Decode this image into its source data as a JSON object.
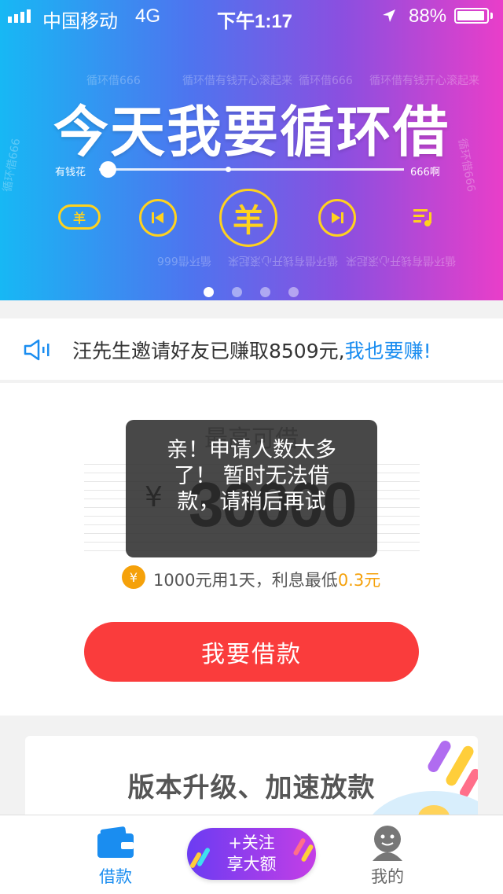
{
  "status_bar": {
    "carrier": "中国移动",
    "network": "4G",
    "time": "下午1:17",
    "battery": "88%"
  },
  "banner": {
    "watermark_a": "循环借有钱开心滚起来",
    "watermark_b": "循环借666",
    "title": "今天我要循环借",
    "slider_left": "有钱花",
    "slider_right": "666啊",
    "center_symbol": "羊",
    "left_symbol": "羊",
    "slides_total": 4,
    "slide_active": 1
  },
  "notice": {
    "text": "汪先生邀请好友已赚取8509元,",
    "link": "我也要赚!"
  },
  "loan": {
    "label": "最高可借",
    "currency": "¥",
    "amount": "30000",
    "info_icon": "¥",
    "info_text": "1000元用1天，利息最低",
    "info_rate": "0.3元",
    "button": "我要借款"
  },
  "toast": {
    "message": "亲！申请人数太多了！ 暂时无法借款，请稍后再试"
  },
  "promo": {
    "title": "版本升级、加速放款"
  },
  "tabbar": {
    "borrow": "借款",
    "follow_line1": "+关注",
    "follow_line2": "享大额",
    "mine": "我的"
  },
  "colors": {
    "accent_blue": "#1a8df0",
    "button_red": "#fa3c3c",
    "rate_orange": "#f5a10a",
    "control_yellow": "#ffd21e"
  }
}
